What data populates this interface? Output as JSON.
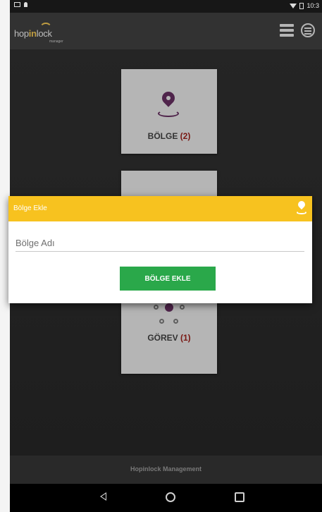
{
  "status_bar": {
    "time": "10:3"
  },
  "app": {
    "logo_left": "hop",
    "logo_mid": "in",
    "logo_right": "lock",
    "logo_sub": "manager"
  },
  "tiles": {
    "region": {
      "label": "BÖLGE",
      "count": "(2)",
      "icon": "location-pin-icon"
    },
    "task": {
      "label": "GÖREV",
      "count": "(1)",
      "icon": "network-icon"
    }
  },
  "dialog": {
    "title": "Bölge Ekle",
    "placeholder": "Bölge Adı",
    "value": "",
    "button_label": "BÖLGE EKLE",
    "colors": {
      "header": "#f7c21f",
      "button": "#2aa84a"
    }
  },
  "footer": {
    "text": "Hopinlock Management"
  }
}
